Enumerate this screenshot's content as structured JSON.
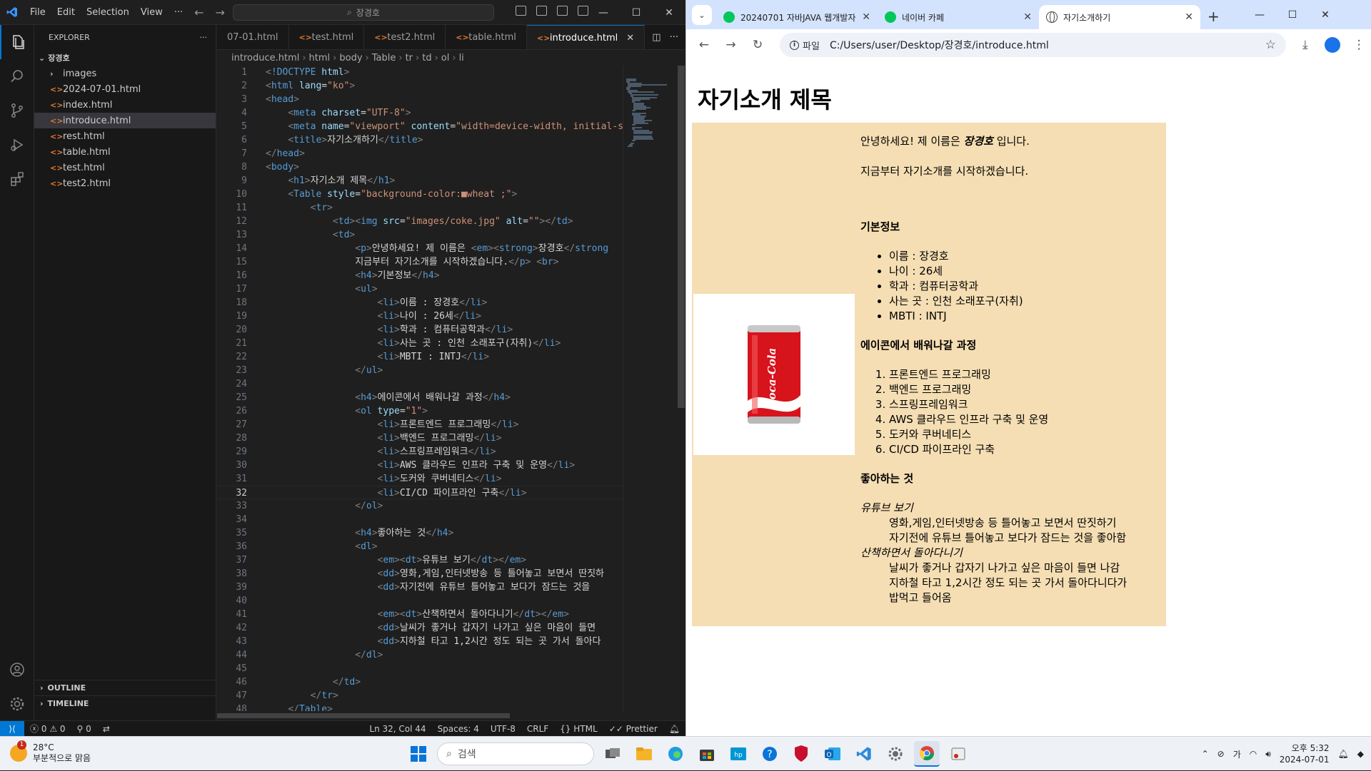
{
  "vscode": {
    "menu": [
      "File",
      "Edit",
      "Selection",
      "View",
      "···"
    ],
    "search_text": "장경호",
    "explorer": {
      "title": "EXPLORER",
      "folder": "장경호",
      "items": [
        {
          "label": "images",
          "type": "folder"
        },
        {
          "label": "2024-07-01.html",
          "type": "file"
        },
        {
          "label": "index.html",
          "type": "file"
        },
        {
          "label": "introduce.html",
          "type": "file",
          "active": true
        },
        {
          "label": "rest.html",
          "type": "file"
        },
        {
          "label": "table.html",
          "type": "file"
        },
        {
          "label": "test.html",
          "type": "file"
        },
        {
          "label": "test2.html",
          "type": "file"
        }
      ],
      "outline": "OUTLINE",
      "timeline": "TIMELINE"
    },
    "tabs": [
      "07-01.html",
      "test.html",
      "test2.html",
      "table.html",
      "introduce.html"
    ],
    "active_tab": "introduce.html",
    "breadcrumbs": [
      "introduce.html",
      "html",
      "body",
      "Table",
      "tr",
      "td",
      "ol",
      "li"
    ],
    "current_line": 32,
    "status": {
      "errors": "0",
      "warnings": "0",
      "ports": "0",
      "position": "Ln 32, Col 44",
      "spaces": "Spaces: 4",
      "encoding": "UTF-8",
      "eol": "CRLF",
      "language": "HTML",
      "formatter": "Prettier"
    }
  },
  "code_lines": [
    "<!DOCTYPE html>",
    "<html lang=\"ko\">",
    "<head>",
    "    <meta charset=\"UTF-8\">",
    "    <meta name=\"viewport\" content=\"width=device-width, initial-sc",
    "    <title>자기소개하기</title>",
    "</head>",
    "<body>",
    "    <h1>자기소개 제목</h1>",
    "    <Table style=\"background-color:■wheat ;\">",
    "        <tr>",
    "            <td><img src=\"images/coke.jpg\" alt=\"\"></td>",
    "            <td>",
    "                <p>안녕하세요! 제 이름은 <em><strong>장경호</strong",
    "                지금부터 자기소개를 시작하겠습니다.</p> <br>",
    "                <h4>기본정보</h4>",
    "                <ul>",
    "                    <li>이름 : 장경호</li>",
    "                    <li>나이 : 26세</li>",
    "                    <li>학과 : 컴퓨터공학과</li>",
    "                    <li>사는 곳 : 인천 소래포구(자취)</li>",
    "                    <li>MBTI : INTJ</li>",
    "                </ul>",
    "",
    "                <h4>에이콘에서 배워나갈 과정</h4>",
    "                <ol type=\"1\">",
    "                    <li>프론트엔드 프로그래밍</li>",
    "                    <li>백엔드 프로그래밍</li>",
    "                    <li>스프링프레임워크</li>",
    "                    <li>AWS 클라우드 인프라 구축 및 운영</li>",
    "                    <li>도커와 쿠버네티스</li>",
    "                    <li>CI/CD 파이프라인 구축</li>",
    "                </ol>",
    "",
    "                <h4>좋아하는 것</h4>",
    "                <dl>",
    "                    <em><dt>유튜브 보기</dt></em>",
    "                    <dd>영화,게임,인터넷방송 등 틀어놓고 보면서 딴짓하",
    "                    <dd>자기전에 유튜브 틀어놓고 보다가 잠드는 것을 ",
    "",
    "                    <em><dt>산책하면서 돌아다니기</dt></em>",
    "                    <dd>날씨가 좋거나 갑자기 나가고 싶은 마음이 들면 ",
    "                    <dd>지하철 타고 1,2시간 정도 되는 곳 가서 돌아다",
    "                </dl>",
    "",
    "            </td>",
    "        </tr>",
    "    </Table>"
  ],
  "chrome": {
    "tabs": [
      {
        "title": "20240701 자바JAVA 웹개발자",
        "icon": "naver-cafe-icon"
      },
      {
        "title": "네이버 카페",
        "icon": "naver-cafe-icon"
      },
      {
        "title": "자기소개하기",
        "icon": "globe-icon",
        "active": true
      }
    ],
    "chip": "파일",
    "url": "C:/Users/user/Desktop/장경호/introduce.html"
  },
  "page": {
    "h1": "자기소개 제목",
    "intro_1a": "안녕하세요! 제 이름은 ",
    "intro_name": "장경호",
    "intro_1b": " 입니다.",
    "intro_2": "지금부터 자기소개를 시작하겠습니다.",
    "h4_basic": "기본정보",
    "basic": [
      "이름 : 장경호",
      "나이 : 26세",
      "학과 : 컴퓨터공학과",
      "사는 곳 : 인천 소래포구(자취)",
      "MBTI : INTJ"
    ],
    "h4_course": "에이콘에서 배워나갈 과정",
    "course": [
      "프론트엔드 프로그래밍",
      "백엔드 프로그래밍",
      "스프링프레임워크",
      "AWS 클라우드 인프라 구축 및 운영",
      "도커와 쿠버네티스",
      "CI/CD 파이프라인 구축"
    ],
    "h4_likes": "좋아하는 것",
    "likes": [
      {
        "dt": "유튜브 보기",
        "dd": [
          "영화,게임,인터넷방송 등 틀어놓고 보면서 딴짓하기",
          "자기전에 유튜브 틀어놓고 보다가 잠드는 것을 좋아함"
        ]
      },
      {
        "dt": "산책하면서 돌아다니기",
        "dd": [
          "날씨가 좋거나 갑자기 나가고 싶은 마음이 들면 나감",
          "지하철 타고 1,2시간 정도 되는 곳 가서 돌아다니다가",
          "밥먹고 들어옴"
        ]
      }
    ],
    "image_text": "Coca-Cola"
  },
  "taskbar": {
    "weather_temp": "28°C",
    "weather_desc": "부분적으로 맑음",
    "weather_badge": "1",
    "search_placeholder": "검색",
    "ime": "가",
    "time": "오후 5:32",
    "date": "2024-07-01"
  }
}
